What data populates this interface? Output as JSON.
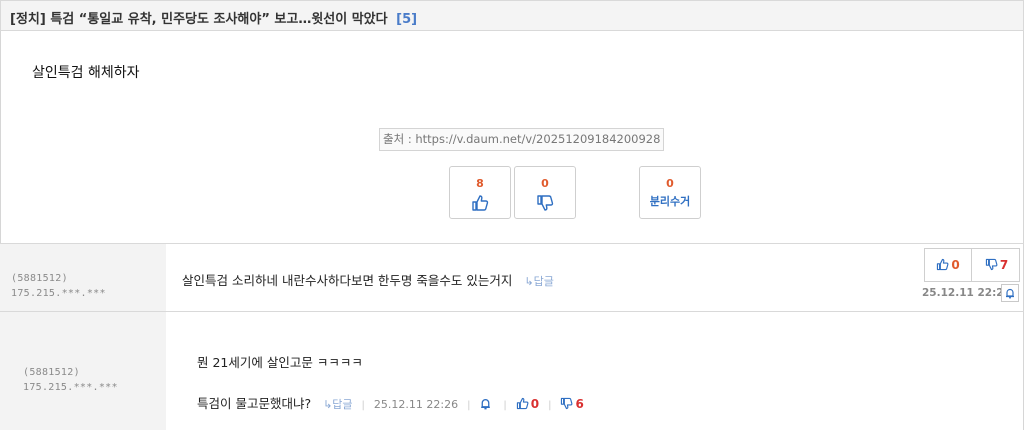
{
  "post": {
    "category": "[정치]",
    "title": "특검 “통일교 유착, 민주당도 조사해야” 보고…윗선이 막았다",
    "comment_count": "[5]",
    "body": "살인특검 해체하자",
    "source": "출처 : https://v.daum.net/v/20251209184200928"
  },
  "votes": {
    "up_count": "8",
    "down_count": "0",
    "recycle_count": "0",
    "recycle_label": "분리수거"
  },
  "comments": [
    {
      "user_id": "(5881512)",
      "ip": "175.215.***.***",
      "text": "살인특검 소리하네 내란수사하다보면 한두명 죽을수도 있는거지",
      "reply_label": "↳답글",
      "up": "0",
      "down": "7",
      "date": "25.12.11 22:23"
    },
    {
      "user_id": "(5881512)",
      "ip": "175.215.***.***",
      "line1": "뭔 21세기에 살인고문 ㅋㅋㅋㅋ",
      "line2": "특검이 물고문했대냐?",
      "reply_label": "↳답글",
      "date": "25.12.11 22:26",
      "up": "0",
      "down": "6"
    }
  ],
  "colors": {
    "accent_blue": "#2f6fc2",
    "count_orange": "#e05a2c",
    "down_red": "#d93030"
  }
}
